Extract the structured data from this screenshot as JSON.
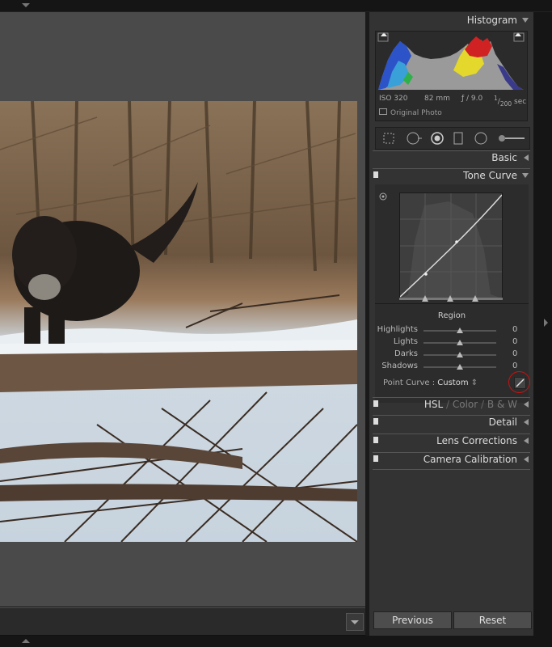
{
  "histogram": {
    "title": "Histogram",
    "iso": "ISO 320",
    "focal": "82 mm",
    "aperture": "ƒ / 9.0",
    "shutter_num": "1",
    "shutter_den": "200",
    "shutter_unit": "sec",
    "original_photo": "Original Photo"
  },
  "panels": {
    "basic": "Basic",
    "tone_curve": "Tone Curve",
    "hsl": "HSL",
    "sep": "/",
    "color": "Color",
    "bw": "B & W",
    "detail": "Detail",
    "lens": "Lens Corrections",
    "calibration": "Camera Calibration"
  },
  "tone_curve": {
    "region": "Region",
    "sliders": [
      {
        "label": "Highlights",
        "value": "0",
        "level": 0.5
      },
      {
        "label": "Lights",
        "value": "0",
        "level": 0.5
      },
      {
        "label": "Darks",
        "value": "0",
        "level": 0.5
      },
      {
        "label": "Shadows",
        "value": "0",
        "level": 0.5
      }
    ],
    "point_curve_label": "Point Curve :",
    "point_curve_value": "Custom"
  },
  "buttons": {
    "previous": "Previous",
    "reset": "Reset"
  },
  "colors": {
    "panel_bg": "#333333",
    "viewer_bg": "#4a4a4a",
    "highlight_circle": "#cc1111"
  },
  "icons": [
    "crop-icon",
    "spot-removal-icon",
    "red-eye-icon",
    "graduated-filter-icon",
    "radial-filter-icon",
    "adjustment-brush-icon",
    "edit-point-curve-icon"
  ]
}
